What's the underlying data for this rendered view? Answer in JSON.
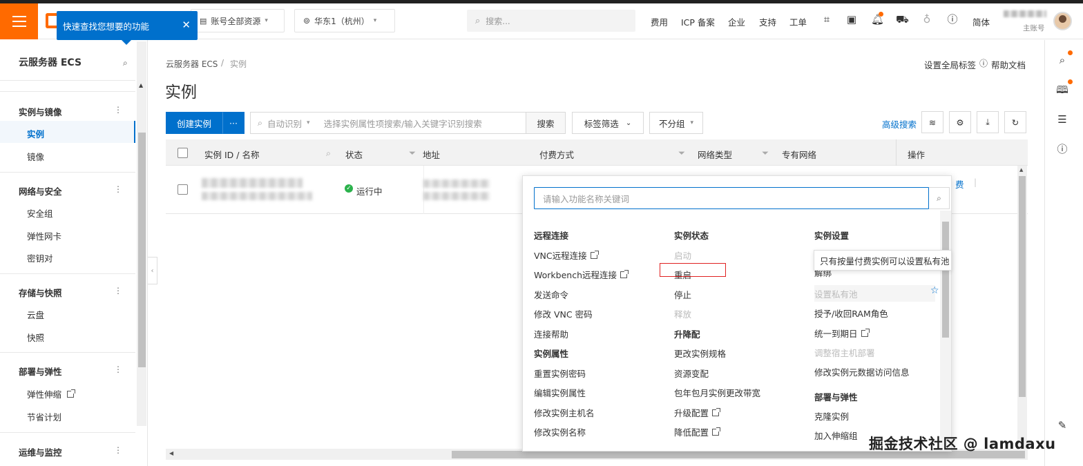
{
  "topbar": {
    "tip": "快速查找您想要的功能",
    "account_scope": "账号全部资源",
    "region": "华东1（杭州）",
    "search_placeholder": "搜索...",
    "nav": [
      "费用",
      "ICP 备案",
      "企业",
      "支持",
      "工单"
    ],
    "lang": "简体",
    "account_label": "主账号"
  },
  "sidebar": {
    "title": "云服务器 ECS",
    "sections": [
      {
        "title": "实例与镜像",
        "items": [
          "实例",
          "镜像"
        ]
      },
      {
        "title": "网络与安全",
        "items": [
          "安全组",
          "弹性网卡",
          "密钥对"
        ]
      },
      {
        "title": "存储与快照",
        "items": [
          "云盘",
          "快照"
        ]
      },
      {
        "title": "部署与弹性",
        "items": [
          "弹性伸缩",
          "节省计划"
        ]
      },
      {
        "title": "运维与监控",
        "items": []
      }
    ],
    "active_item": "实例"
  },
  "page": {
    "breadcrumb_root": "云服务器 ECS",
    "breadcrumb_sep": "/",
    "breadcrumb_current": "实例",
    "title": "实例",
    "global_tags": "设置全局标签",
    "help_docs": "帮助文档"
  },
  "toolbar": {
    "create": "创建实例",
    "more": "···",
    "auto_detect": "自动识别",
    "filter_placeholder": "选择实例属性项搜索/输入关键字识别搜索",
    "search_btn": "搜索",
    "tag_filter": "标签筛选",
    "grouping": "不分组",
    "advanced_search": "高级搜索"
  },
  "table": {
    "headers": [
      "实例 ID / 名称",
      "状态",
      "地址",
      "付费方式",
      "网络类型",
      "专有网络",
      "操作"
    ],
    "rows": [
      {
        "status": "运行中",
        "action_fragment": "费"
      }
    ]
  },
  "popup": {
    "search_placeholder": "请输入功能名称关键词",
    "col1": [
      {
        "type": "header",
        "text": "远程连接"
      },
      {
        "type": "item",
        "text": "VNC远程连接",
        "ext": true
      },
      {
        "type": "item",
        "text": "Workbench远程连接",
        "ext": true
      },
      {
        "type": "item",
        "text": "发送命令"
      },
      {
        "type": "item",
        "text": "修改 VNC 密码"
      },
      {
        "type": "item",
        "text": "连接帮助"
      },
      {
        "type": "header",
        "text": "实例属性"
      },
      {
        "type": "item",
        "text": "重置实例密码"
      },
      {
        "type": "item",
        "text": "编辑实例属性"
      },
      {
        "type": "item",
        "text": "修改实例主机名"
      },
      {
        "type": "item",
        "text": "修改实例名称"
      }
    ],
    "col2": [
      {
        "type": "header",
        "text": "实例状态"
      },
      {
        "type": "item",
        "text": "启动",
        "disabled": true
      },
      {
        "type": "item",
        "text": "重启"
      },
      {
        "type": "item",
        "text": "停止"
      },
      {
        "type": "item",
        "text": "释放",
        "disabled": true
      },
      {
        "type": "header",
        "text": "升降配"
      },
      {
        "type": "item",
        "text": "更改实例规格"
      },
      {
        "type": "item",
        "text": "资源变配"
      },
      {
        "type": "item",
        "text": "包年包月实例更改带宽"
      },
      {
        "type": "item",
        "text": "升级配置",
        "ext": true
      },
      {
        "type": "item",
        "text": "降低配置",
        "ext": true
      }
    ],
    "col3": [
      {
        "type": "header",
        "text": "实例设置"
      },
      {
        "type": "item",
        "text": "设置私有池",
        "disabled": true
      },
      {
        "type": "item",
        "text": "授予/收回RAM角色"
      },
      {
        "type": "item",
        "text": "统一到期日",
        "ext": true
      },
      {
        "type": "item",
        "text": "调整宿主机部署",
        "disabled": true
      },
      {
        "type": "item",
        "text": "修改实例元数据访问信息"
      },
      {
        "type": "header",
        "text": "部署与弹性"
      },
      {
        "type": "item",
        "text": "克隆实例"
      },
      {
        "type": "item",
        "text": "加入伸缩组"
      }
    ],
    "col3_partial_hidden": "解绑",
    "tooltip": "只有按量付费实例可以设置私有池"
  },
  "watermark": "掘金技术社区 @ lamdaxu",
  "colors": {
    "brand": "#ff6a00",
    "primary": "#0070cc",
    "highlight": "#e02020",
    "running": "#2bb24c"
  }
}
